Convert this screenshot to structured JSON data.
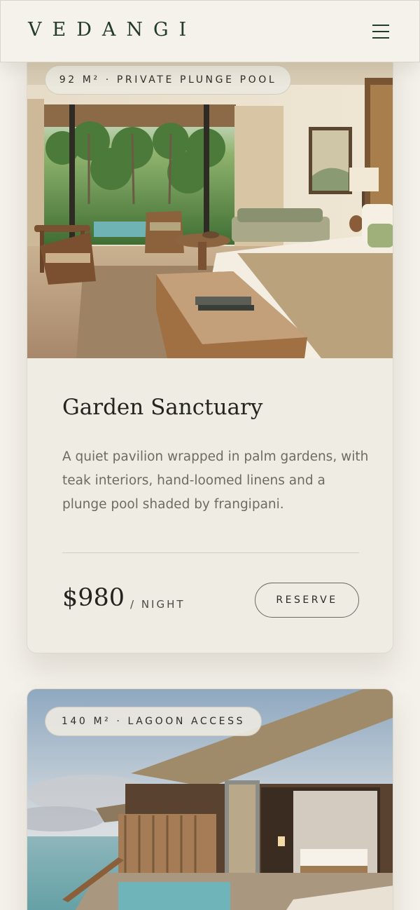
{
  "header": {
    "logo": "VEDANGI",
    "menu_icon": "hamburger-menu-icon"
  },
  "rooms": [
    {
      "badge": "92 M² · PRIVATE PLUNGE POOL",
      "name": "Garden Sanctuary",
      "description": "A quiet pavilion wrapped in palm gardens, with teak interiors, hand-loomed linens and a plunge pool shaded by frangipani.",
      "price": "$980",
      "unit": "/ NIGHT",
      "cta": "RESERVE",
      "image": "garden-villa-bedroom-photo"
    },
    {
      "badge": "140 M² · LAGOON ACCESS",
      "image": "overwater-villa-photo"
    }
  ],
  "colors": {
    "background": "#f4f1ea",
    "card": "#efece4",
    "brand_green": "#233b2b",
    "text": "#23241f",
    "muted": "#6e6b63"
  }
}
